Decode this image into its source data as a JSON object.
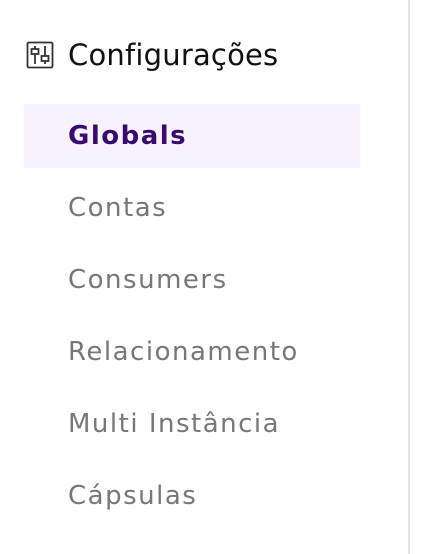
{
  "sidebar": {
    "section": {
      "icon": "settings-sliders-icon",
      "title": "Configurações"
    },
    "items": [
      {
        "label": "Globals",
        "active": true
      },
      {
        "label": "Contas",
        "active": false
      },
      {
        "label": "Consumers",
        "active": false
      },
      {
        "label": "Relacionamento",
        "active": false
      },
      {
        "label": "Multi Instância",
        "active": false
      },
      {
        "label": "Cápsulas",
        "active": false
      }
    ]
  },
  "colors": {
    "active_text": "#3a0a6e",
    "active_background": "#f7f2fd",
    "inactive_text": "#777777",
    "title_text": "#111111",
    "divider": "#e4e4e4"
  }
}
